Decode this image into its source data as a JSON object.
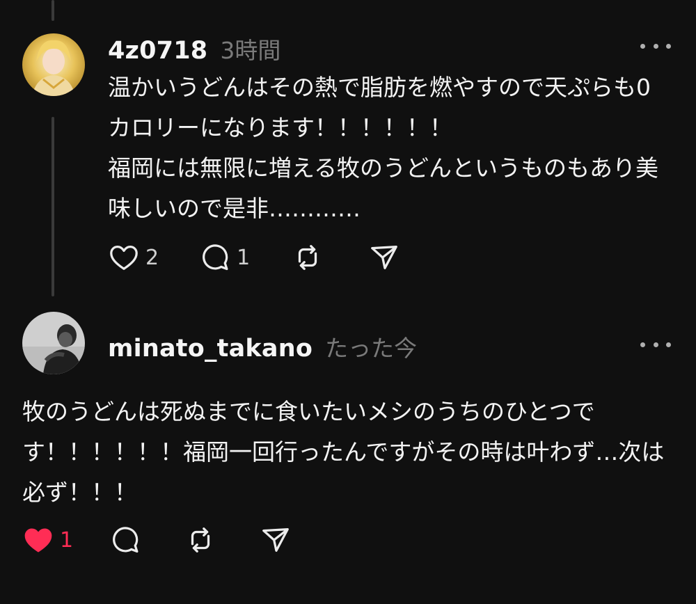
{
  "post1": {
    "username": "4z0718",
    "timestamp": "3時間",
    "text_para1": "温かいうどんはその熱で脂肪を燃やすので天ぷらも0カロリーになります！！！！！！",
    "text_para2": "福岡には無限に増える牧のうどんというものもあり美味しいので是非…………",
    "like_count": "2",
    "reply_count": "1",
    "liked": false
  },
  "post2": {
    "username": "minato_takano",
    "timestamp": "たった今",
    "text": "牧のうどんは死ぬまでに食いたいメシのうちのひとつです！！！！！！福岡一回行ったんですがその時は叶わず…次は必ず！！！",
    "like_count": "1",
    "liked": true
  },
  "colors": {
    "background": "#101010",
    "text_primary": "#f3f3f3",
    "text_secondary": "#7a7a7a",
    "like_active": "#ff2d55",
    "thread_line": "#3a3a3a"
  },
  "icons": {
    "like": "heart-icon",
    "reply": "comment-bubble-icon",
    "repost": "repost-icon",
    "share": "send-icon",
    "more": "more-dots-icon"
  }
}
